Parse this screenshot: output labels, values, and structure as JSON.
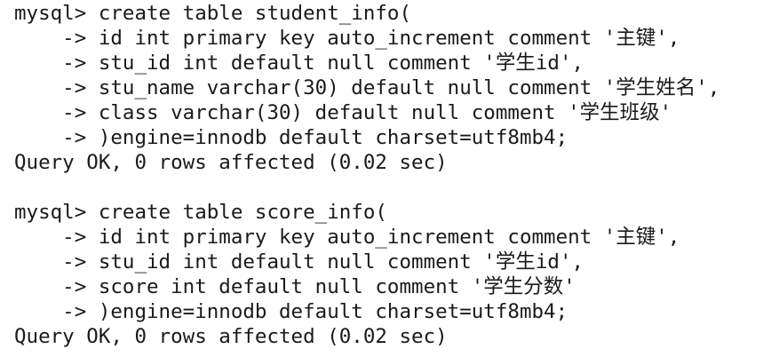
{
  "terminal": {
    "lines": [
      "mysql> create table student_info(",
      "    -> id int primary key auto_increment comment '主键',",
      "    -> stu_id int default null comment '学生id',",
      "    -> stu_name varchar(30) default null comment '学生姓名',",
      "    -> class varchar(30) default null comment '学生班级'",
      "    -> )engine=innodb default charset=utf8mb4;",
      "Query OK, 0 rows affected (0.02 sec)",
      "",
      "mysql> create table score_info(",
      "    -> id int primary key auto_increment comment '主键',",
      "    -> stu_id int default null comment '学生id',",
      "    -> score int default null comment '学生分数'",
      "    -> )engine=innodb default charset=utf8mb4;",
      "Query OK, 0 rows affected (0.02 sec)"
    ]
  }
}
